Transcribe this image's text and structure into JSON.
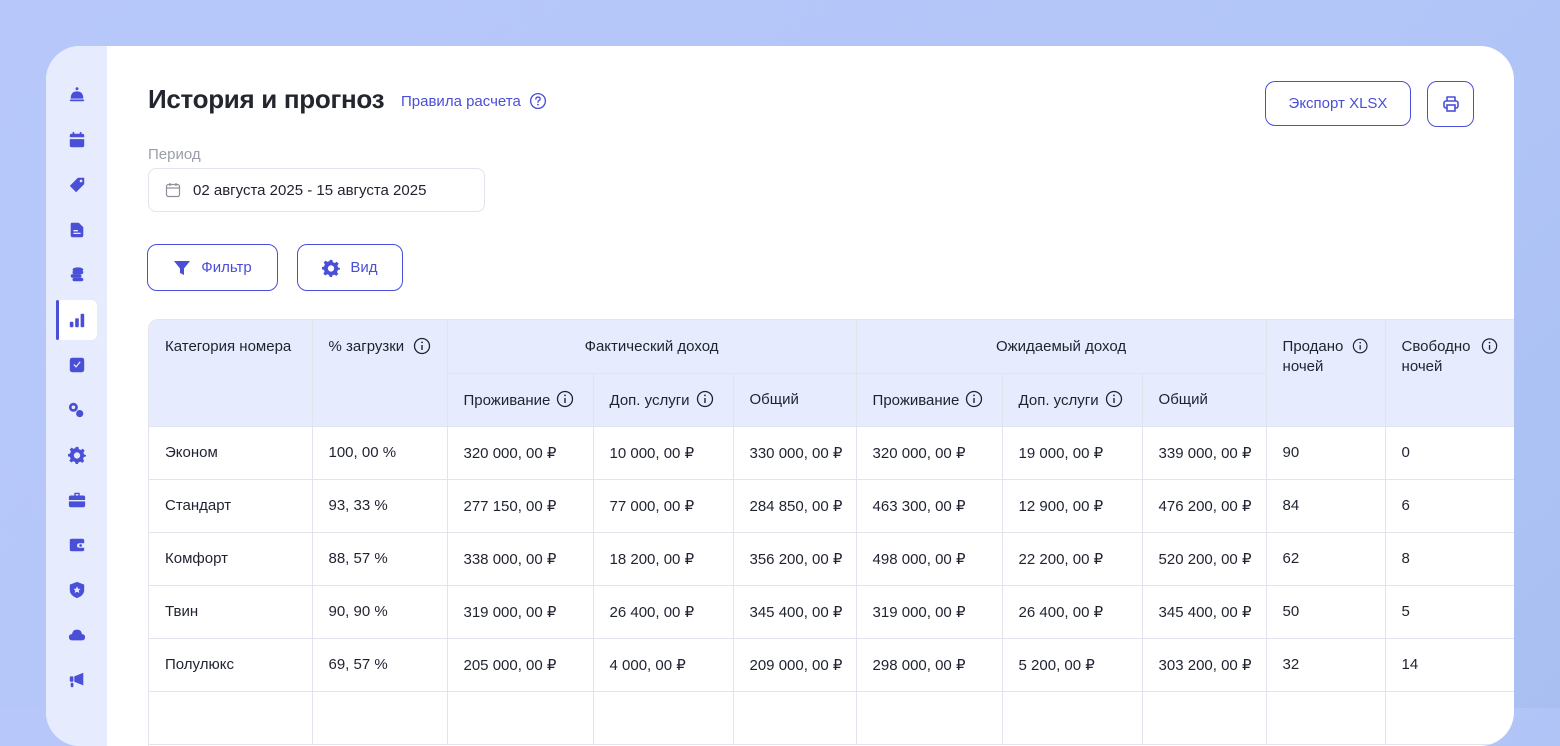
{
  "page": {
    "title": "История и прогноз",
    "rules_link": "Правила расчета",
    "export_label": "Экспорт XLSX",
    "accent_color": "#4a4fd8"
  },
  "sidebar": {
    "items": [
      {
        "icon": "bell-icon"
      },
      {
        "icon": "calendar-icon"
      },
      {
        "icon": "tag-icon"
      },
      {
        "icon": "document-icon"
      },
      {
        "icon": "coins-icon"
      },
      {
        "icon": "bar-chart-icon",
        "active": true
      },
      {
        "icon": "checkbox-icon"
      },
      {
        "icon": "key-icon"
      },
      {
        "icon": "gear-icon"
      },
      {
        "icon": "briefcase-icon"
      },
      {
        "icon": "wallet-icon"
      },
      {
        "icon": "shield-star-icon"
      },
      {
        "icon": "cloud-icon"
      },
      {
        "icon": "megaphone-icon"
      }
    ]
  },
  "period": {
    "label": "Период",
    "value": "02 августа 2025 - 15 августа 2025"
  },
  "toolbar": {
    "filter_label": "Фильтр",
    "view_label": "Вид"
  },
  "table": {
    "headers": {
      "category": "Категория номера",
      "load": "% загрузки",
      "actual": "Фактический доход",
      "expected": "Ожидаемый доход",
      "sold": "Продано ночей",
      "free": "Свободно ночей",
      "accommodation": "Проживание",
      "extra": "Доп. услуги",
      "total": "Общий"
    },
    "rows": [
      [
        "Эконом",
        "100, 00 %",
        "320 000, 00 ₽",
        "10 000, 00 ₽",
        "330 000, 00 ₽",
        "320 000, 00 ₽",
        "19 000, 00 ₽",
        "339 000, 00 ₽",
        "90",
        "0"
      ],
      [
        "Стандарт",
        "93, 33 %",
        "277 150, 00 ₽",
        "77 000, 00 ₽",
        "284 850, 00 ₽",
        "463 300, 00 ₽",
        "12 900, 00 ₽",
        "476 200, 00 ₽",
        "84",
        "6"
      ],
      [
        "Комфорт",
        "88, 57 %",
        "338 000, 00 ₽",
        "18 200, 00 ₽",
        "356 200, 00 ₽",
        "498 000, 00 ₽",
        "22 200, 00 ₽",
        "520 200, 00 ₽",
        "62",
        "8"
      ],
      [
        "Твин",
        "90, 90 %",
        "319 000, 00 ₽",
        "26 400, 00 ₽",
        "345 400, 00 ₽",
        "319 000, 00 ₽",
        "26 400, 00 ₽",
        "345 400, 00 ₽",
        "50",
        "5"
      ],
      [
        "Полулюкс",
        "69, 57 %",
        "205 000, 00 ₽",
        "4 000, 00 ₽",
        "209 000, 00 ₽",
        "298 000, 00 ₽",
        "5 200, 00 ₽",
        "303 200, 00 ₽",
        "32",
        "14"
      ],
      [
        "",
        "",
        "",
        "",
        "",
        "",
        "",
        "",
        "",
        ""
      ]
    ]
  }
}
